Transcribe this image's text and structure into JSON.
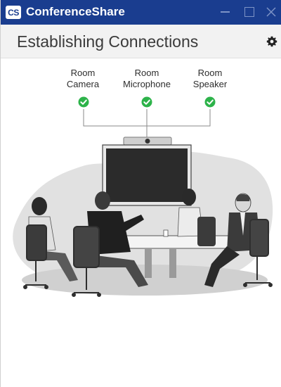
{
  "window": {
    "logo_text": "CS",
    "app_title": "ConferenceShare"
  },
  "header": {
    "title": "Establishing Connections"
  },
  "devices": [
    {
      "line1": "Room",
      "line2": "Camera",
      "status": "connected"
    },
    {
      "line1": "Room",
      "line2": "Microphone",
      "status": "connected"
    },
    {
      "line1": "Room",
      "line2": "Speaker",
      "status": "connected"
    }
  ],
  "colors": {
    "titlebar": "#1a3d8f",
    "check": "#2db34a",
    "header_bg": "#f2f2f2"
  },
  "icons": {
    "settings": "gear-icon",
    "status": "check-circle-icon",
    "minimize": "minimize-icon",
    "maximize": "maximize-icon",
    "close": "close-icon"
  }
}
